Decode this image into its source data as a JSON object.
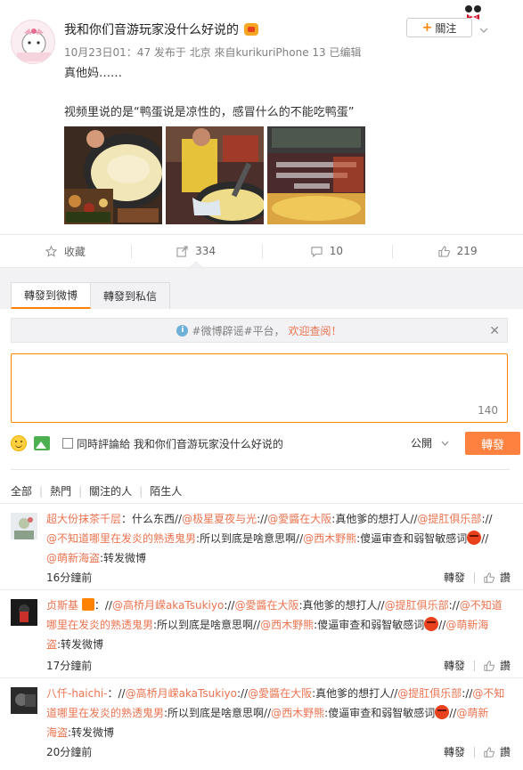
{
  "post": {
    "author": "我和你们音游玩家没什么好说的",
    "follow_label": "關注",
    "meta": "10月23日01：47 发布于 北京 來自kurikuriPhone 13   已编辑",
    "content_line1": "真他妈……",
    "content_line2": "视频里说的是“鸭蛋说是凉性的，感冒什么的不能吃鸭蛋”"
  },
  "actions": {
    "favorite": "收藏",
    "repost_count": "334",
    "comment_count": "10",
    "like_count": "219"
  },
  "repost_panel": {
    "tab_weibo": "轉發到微博",
    "tab_message": "轉發到私信",
    "notice_prefix": "#微博辟谣#平台，",
    "notice_link": "欢迎查阅！",
    "char_count": "140",
    "also_comment_label": "同時評論給 我和你们音游玩家没什么好说的",
    "visibility": "公開",
    "submit_label": "轉發"
  },
  "filters": [
    "全部",
    "熱門",
    "關注的人",
    "陌生人"
  ],
  "reposts": [
    {
      "user": "超大份抹茶千层",
      "line1_a": "：什么东西//",
      "line1_b": "@极星夏夜与光",
      "line1_c": "://",
      "line1_d": "@愛醬在大阪",
      "line1_e": ":真他爹的想打人//",
      "line1_f": "@提肛俱乐部",
      "line1_g": "://",
      "line2_a": "@不知道哪里在发炎的熟透鬼男",
      "line2_b": ":所以到底是啥意思啊//",
      "line2_c": "@西木野熊",
      "line2_d": ":傻逼审查和弱智敏感词",
      "line2_e": "//",
      "line3_a": "@萌新海盗",
      "line3_b": ":转发微博",
      "time": "16分鐘前",
      "repost_label": "轉發",
      "like_label": "讚"
    },
    {
      "user": "贞斯基",
      "line1_a": "：//",
      "line1_b": "@高桥月嵘akaTsukiyo",
      "line1_c": "://",
      "line1_d": "@愛醬在大阪",
      "line1_e": ":真他爹的想打人//",
      "line1_f": "@提肛俱乐部",
      "line1_g": "://",
      "line1_h": "@不知道",
      "line2_a": "哪里在发炎的熟透鬼男",
      "line2_b": ":所以到底是啥意思啊//",
      "line2_c": "@西木野熊",
      "line2_d": ":傻逼审查和弱智敏感词",
      "line2_e": "//",
      "line2_f": "@萌新海",
      "line3_a": "盗",
      "line3_b": ":转发微博",
      "time": "17分鐘前",
      "repost_label": "轉發",
      "like_label": "讚"
    },
    {
      "user": "八仟-haichi-",
      "line1_a": "：//",
      "line1_b": "@高桥月嵘akaTsukiyo",
      "line1_c": "://",
      "line1_d": "@愛醬在大阪",
      "line1_e": ":真他爹的想打人//",
      "line1_f": "@提肛俱乐部",
      "line1_g": "://",
      "line1_h": "@不知",
      "line2_a": "道哪里在发炎的熟透鬼男",
      "line2_b": ":所以到底是啥意思啊//",
      "line2_c": "@西木野熊",
      "line2_d": ":傻逼审查和弱智敏感词",
      "line2_e": "//",
      "line2_f": "@萌新",
      "line3_a": "海盗",
      "line3_b": ":转发微博",
      "time": "20分鐘前",
      "repost_label": "轉發",
      "like_label": "讚"
    }
  ],
  "colors": {
    "accent": "#ff8200",
    "link": "#eb7350",
    "submit": "#ff8140"
  }
}
